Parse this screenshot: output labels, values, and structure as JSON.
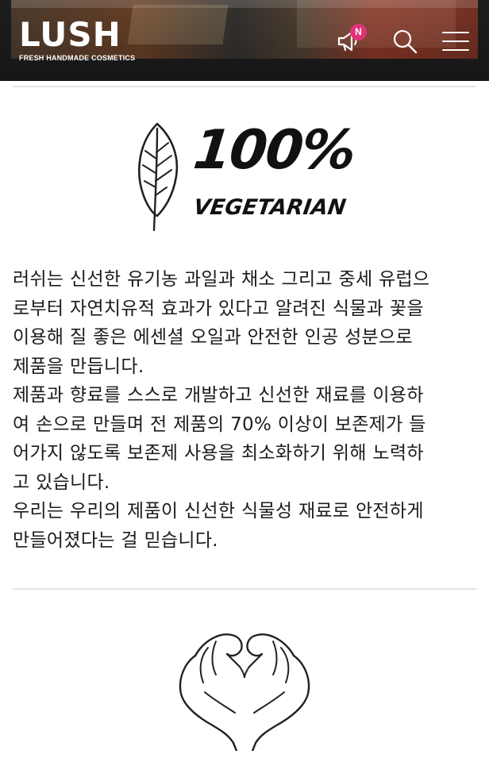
{
  "header": {
    "logo_text": "LUSH",
    "logo_subtitle": "FRESH HANDMADE COSMETICS",
    "notification_badge": "N",
    "icons": [
      "megaphone-icon",
      "search-icon",
      "hamburger-menu-icon"
    ],
    "background_color": "#222222",
    "badge_color": "#e2337a"
  },
  "vegetarian": {
    "percent_text": "100%",
    "label": "VEGETARIAN"
  },
  "intro": {
    "lines": [
      "러쉬는 신선한 유기농 과일과 채소 그리고 중세 유럽으",
      "로부터 자연치유적 효과가 있다고 알려진 식물과 꽃을",
      "이용해 질 좋은 에센셜 오일과 안전한 인공 성분으로",
      "제품을 만듭니다.",
      "제품과 향료를 스스로 개발하고 신선한 재료를 이용하",
      "여 손으로 만들며 전 제품의 70% 이상이 보존제가 들",
      "어가지 않도록 보존제 사용을 최소화하기 위해 노력하",
      "고 있습니다.",
      "우리는 우리의 제품이 신선한 식물성 재료로 안전하게",
      "만들어졌다는 걸 믿습니다."
    ]
  }
}
